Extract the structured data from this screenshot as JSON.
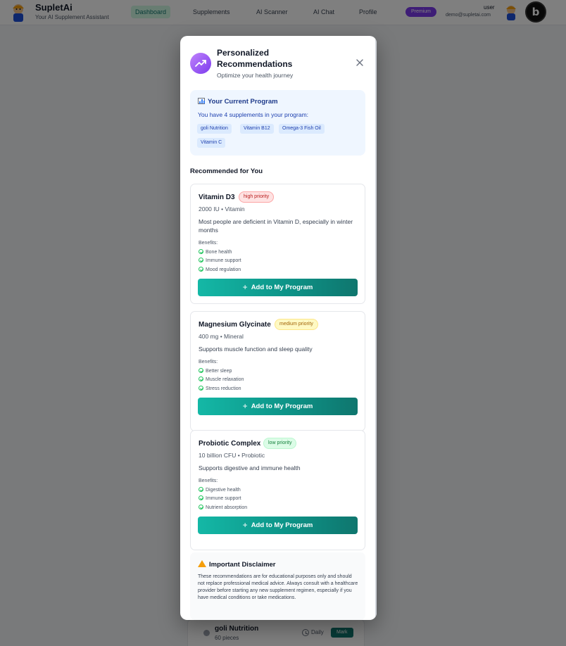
{
  "nav": {
    "brand": "SupletAi",
    "tagline": "Your AI Supplement Assistant",
    "items": [
      {
        "label": "Dashboard",
        "active": true
      },
      {
        "label": "Supplements",
        "active": false
      },
      {
        "label": "AI Scanner",
        "active": false
      },
      {
        "label": "AI Chat",
        "active": false
      },
      {
        "label": "Profile",
        "active": false
      }
    ],
    "premium_label": "Premium",
    "user_name": "user",
    "user_email": "demo@supletai.com",
    "badge_letter": "b"
  },
  "background": {
    "row_name": "goli Nutrition",
    "row_qty": "60 pieces",
    "row_freq": "Daily",
    "row_action": "Mark"
  },
  "modal": {
    "title": "Personalized Recommendations",
    "subtitle": "Optimize your health journey",
    "program": {
      "title": "Your Current Program",
      "text": "You have 4 supplements in your program:",
      "chips": [
        "goli Nutrition",
        "Vitamin B12",
        "Omega-3 Fish Oil",
        "Vitamin C"
      ]
    },
    "section_title": "Recommended for You",
    "benefits_label": "Benefits:",
    "add_label": "Add to My Program",
    "cards": [
      {
        "name": "Vitamin D3",
        "priority": "high priority",
        "dose": "2000 IU • Vitamin",
        "desc": "Most people are deficient in Vitamin D, especially in winter months",
        "benefits": [
          "Bone health",
          "Immune support",
          "Mood regulation"
        ]
      },
      {
        "name": "Magnesium Glycinate",
        "priority": "medium priority",
        "dose": "400 mg • Mineral",
        "desc": "Supports muscle function and sleep quality",
        "benefits": [
          "Better sleep",
          "Muscle relaxation",
          "Stress reduction"
        ]
      },
      {
        "name": "Probiotic Complex",
        "priority": "low priority",
        "dose": "10 billion CFU • Probiotic",
        "desc": "Supports digestive and immune health",
        "benefits": [
          "Digestive health",
          "Immune support",
          "Nutrient absorption"
        ]
      }
    ],
    "disclaimer": {
      "title": "Important Disclaimer",
      "text": "These recommendations are for educational purposes only and should not replace professional medical advice. Always consult with a healthcare provider before starting any new supplement regimen, especially if you have medical conditions or take medications."
    }
  },
  "colors": {
    "accent": "#0d9488",
    "premium": "#7c3aed",
    "program_bg": "#eff6ff"
  }
}
